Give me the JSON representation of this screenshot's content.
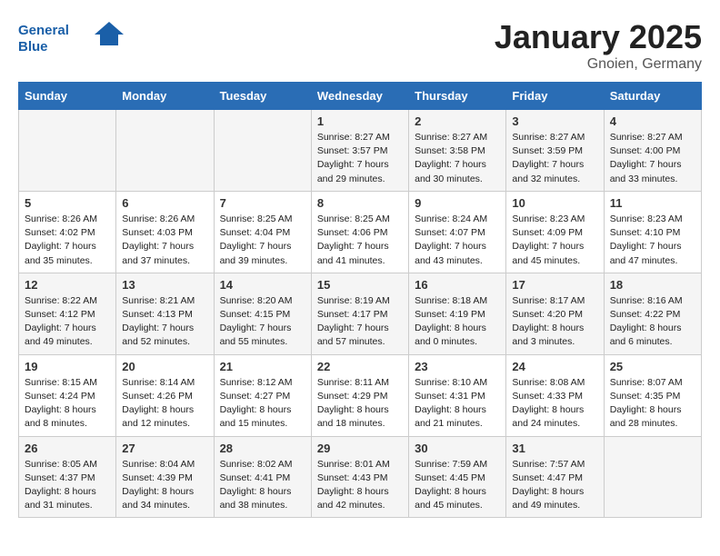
{
  "logo": {
    "line1": "General",
    "line2": "Blue"
  },
  "title": "January 2025",
  "subtitle": "Gnoien, Germany",
  "weekdays": [
    "Sunday",
    "Monday",
    "Tuesday",
    "Wednesday",
    "Thursday",
    "Friday",
    "Saturday"
  ],
  "weeks": [
    [
      {
        "day": "",
        "sunrise": "",
        "sunset": "",
        "daylight": ""
      },
      {
        "day": "",
        "sunrise": "",
        "sunset": "",
        "daylight": ""
      },
      {
        "day": "",
        "sunrise": "",
        "sunset": "",
        "daylight": ""
      },
      {
        "day": "1",
        "sunrise": "Sunrise: 8:27 AM",
        "sunset": "Sunset: 3:57 PM",
        "daylight": "Daylight: 7 hours and 29 minutes."
      },
      {
        "day": "2",
        "sunrise": "Sunrise: 8:27 AM",
        "sunset": "Sunset: 3:58 PM",
        "daylight": "Daylight: 7 hours and 30 minutes."
      },
      {
        "day": "3",
        "sunrise": "Sunrise: 8:27 AM",
        "sunset": "Sunset: 3:59 PM",
        "daylight": "Daylight: 7 hours and 32 minutes."
      },
      {
        "day": "4",
        "sunrise": "Sunrise: 8:27 AM",
        "sunset": "Sunset: 4:00 PM",
        "daylight": "Daylight: 7 hours and 33 minutes."
      }
    ],
    [
      {
        "day": "5",
        "sunrise": "Sunrise: 8:26 AM",
        "sunset": "Sunset: 4:02 PM",
        "daylight": "Daylight: 7 hours and 35 minutes."
      },
      {
        "day": "6",
        "sunrise": "Sunrise: 8:26 AM",
        "sunset": "Sunset: 4:03 PM",
        "daylight": "Daylight: 7 hours and 37 minutes."
      },
      {
        "day": "7",
        "sunrise": "Sunrise: 8:25 AM",
        "sunset": "Sunset: 4:04 PM",
        "daylight": "Daylight: 7 hours and 39 minutes."
      },
      {
        "day": "8",
        "sunrise": "Sunrise: 8:25 AM",
        "sunset": "Sunset: 4:06 PM",
        "daylight": "Daylight: 7 hours and 41 minutes."
      },
      {
        "day": "9",
        "sunrise": "Sunrise: 8:24 AM",
        "sunset": "Sunset: 4:07 PM",
        "daylight": "Daylight: 7 hours and 43 minutes."
      },
      {
        "day": "10",
        "sunrise": "Sunrise: 8:23 AM",
        "sunset": "Sunset: 4:09 PM",
        "daylight": "Daylight: 7 hours and 45 minutes."
      },
      {
        "day": "11",
        "sunrise": "Sunrise: 8:23 AM",
        "sunset": "Sunset: 4:10 PM",
        "daylight": "Daylight: 7 hours and 47 minutes."
      }
    ],
    [
      {
        "day": "12",
        "sunrise": "Sunrise: 8:22 AM",
        "sunset": "Sunset: 4:12 PM",
        "daylight": "Daylight: 7 hours and 49 minutes."
      },
      {
        "day": "13",
        "sunrise": "Sunrise: 8:21 AM",
        "sunset": "Sunset: 4:13 PM",
        "daylight": "Daylight: 7 hours and 52 minutes."
      },
      {
        "day": "14",
        "sunrise": "Sunrise: 8:20 AM",
        "sunset": "Sunset: 4:15 PM",
        "daylight": "Daylight: 7 hours and 55 minutes."
      },
      {
        "day": "15",
        "sunrise": "Sunrise: 8:19 AM",
        "sunset": "Sunset: 4:17 PM",
        "daylight": "Daylight: 7 hours and 57 minutes."
      },
      {
        "day": "16",
        "sunrise": "Sunrise: 8:18 AM",
        "sunset": "Sunset: 4:19 PM",
        "daylight": "Daylight: 8 hours and 0 minutes."
      },
      {
        "day": "17",
        "sunrise": "Sunrise: 8:17 AM",
        "sunset": "Sunset: 4:20 PM",
        "daylight": "Daylight: 8 hours and 3 minutes."
      },
      {
        "day": "18",
        "sunrise": "Sunrise: 8:16 AM",
        "sunset": "Sunset: 4:22 PM",
        "daylight": "Daylight: 8 hours and 6 minutes."
      }
    ],
    [
      {
        "day": "19",
        "sunrise": "Sunrise: 8:15 AM",
        "sunset": "Sunset: 4:24 PM",
        "daylight": "Daylight: 8 hours and 8 minutes."
      },
      {
        "day": "20",
        "sunrise": "Sunrise: 8:14 AM",
        "sunset": "Sunset: 4:26 PM",
        "daylight": "Daylight: 8 hours and 12 minutes."
      },
      {
        "day": "21",
        "sunrise": "Sunrise: 8:12 AM",
        "sunset": "Sunset: 4:27 PM",
        "daylight": "Daylight: 8 hours and 15 minutes."
      },
      {
        "day": "22",
        "sunrise": "Sunrise: 8:11 AM",
        "sunset": "Sunset: 4:29 PM",
        "daylight": "Daylight: 8 hours and 18 minutes."
      },
      {
        "day": "23",
        "sunrise": "Sunrise: 8:10 AM",
        "sunset": "Sunset: 4:31 PM",
        "daylight": "Daylight: 8 hours and 21 minutes."
      },
      {
        "day": "24",
        "sunrise": "Sunrise: 8:08 AM",
        "sunset": "Sunset: 4:33 PM",
        "daylight": "Daylight: 8 hours and 24 minutes."
      },
      {
        "day": "25",
        "sunrise": "Sunrise: 8:07 AM",
        "sunset": "Sunset: 4:35 PM",
        "daylight": "Daylight: 8 hours and 28 minutes."
      }
    ],
    [
      {
        "day": "26",
        "sunrise": "Sunrise: 8:05 AM",
        "sunset": "Sunset: 4:37 PM",
        "daylight": "Daylight: 8 hours and 31 minutes."
      },
      {
        "day": "27",
        "sunrise": "Sunrise: 8:04 AM",
        "sunset": "Sunset: 4:39 PM",
        "daylight": "Daylight: 8 hours and 34 minutes."
      },
      {
        "day": "28",
        "sunrise": "Sunrise: 8:02 AM",
        "sunset": "Sunset: 4:41 PM",
        "daylight": "Daylight: 8 hours and 38 minutes."
      },
      {
        "day": "29",
        "sunrise": "Sunrise: 8:01 AM",
        "sunset": "Sunset: 4:43 PM",
        "daylight": "Daylight: 8 hours and 42 minutes."
      },
      {
        "day": "30",
        "sunrise": "Sunrise: 7:59 AM",
        "sunset": "Sunset: 4:45 PM",
        "daylight": "Daylight: 8 hours and 45 minutes."
      },
      {
        "day": "31",
        "sunrise": "Sunrise: 7:57 AM",
        "sunset": "Sunset: 4:47 PM",
        "daylight": "Daylight: 8 hours and 49 minutes."
      },
      {
        "day": "",
        "sunrise": "",
        "sunset": "",
        "daylight": ""
      }
    ]
  ]
}
